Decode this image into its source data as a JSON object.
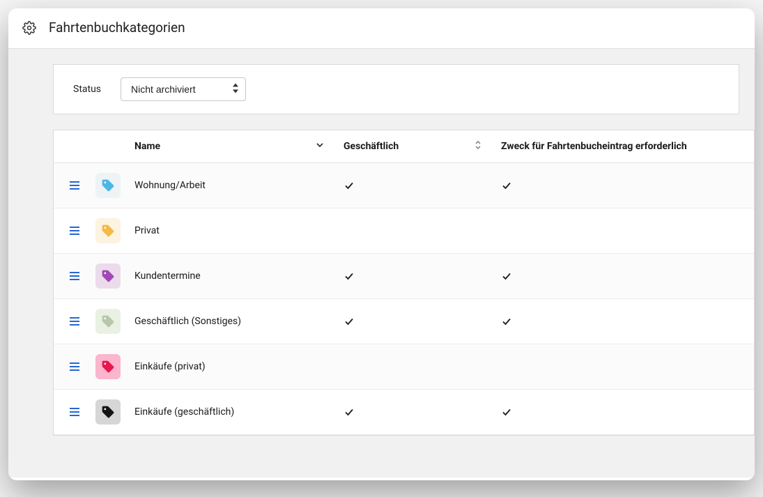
{
  "header": {
    "title": "Fahrtenbuchkategorien"
  },
  "filter": {
    "label": "Status",
    "selected": "Nicht archiviert"
  },
  "table": {
    "columns": {
      "name": "Name",
      "business": "Geschäftlich",
      "purpose": "Zweck für Fahrtenbucheintrag erforderlich"
    },
    "rows": [
      {
        "name": "Wohnung/Arbeit",
        "business": true,
        "purpose_required": true,
        "bg": "#eef3f6",
        "fg": "#4db6e8"
      },
      {
        "name": "Privat",
        "business": false,
        "purpose_required": false,
        "bg": "#fdf3e1",
        "fg": "#f3b94a"
      },
      {
        "name": "Kundentermine",
        "business": true,
        "purpose_required": true,
        "bg": "#ecdceb",
        "fg": "#a348b8"
      },
      {
        "name": "Geschäftlich (Sonstiges)",
        "business": true,
        "purpose_required": true,
        "bg": "#e9f1e3",
        "fg": "#b8c7ac"
      },
      {
        "name": "Einkäufe (privat)",
        "business": false,
        "purpose_required": false,
        "bg": "#fbb5cd",
        "fg": "#e8174f"
      },
      {
        "name": "Einkäufe (geschäftlich)",
        "business": true,
        "purpose_required": true,
        "bg": "#d6d6d6",
        "fg": "#141414"
      }
    ]
  }
}
